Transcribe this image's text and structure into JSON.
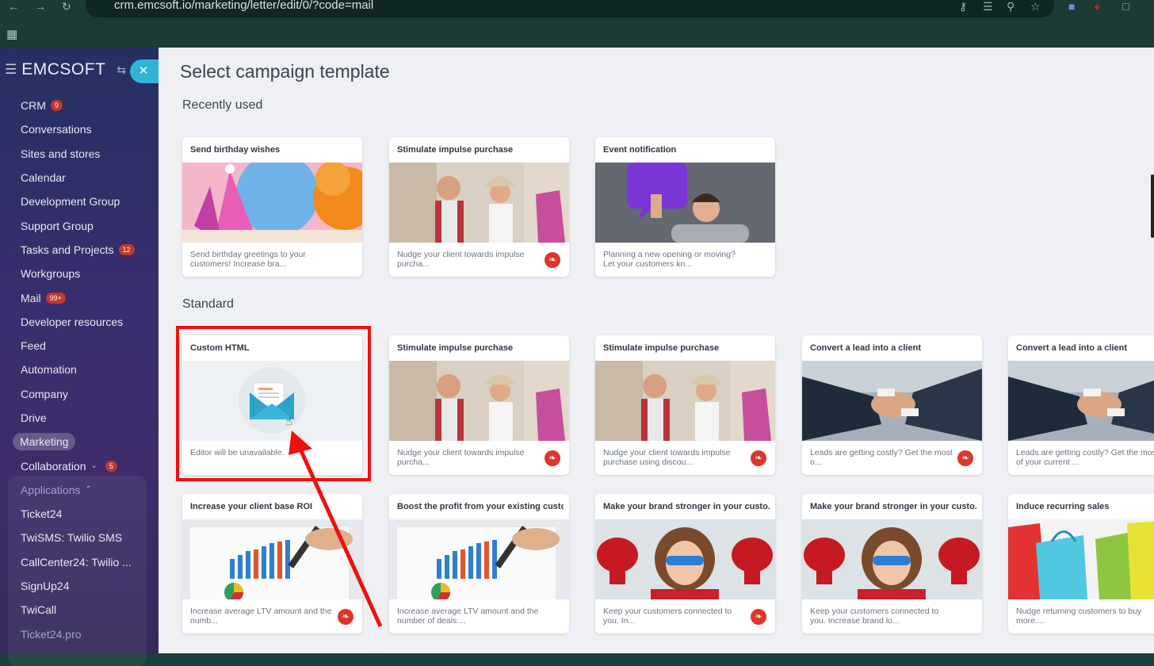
{
  "browser": {
    "url": "crm.emcsoft.io/marketing/letter/edit/0/?code=mail"
  },
  "sidebar": {
    "logo": "EMCSOFT",
    "items": [
      {
        "label": "CRM",
        "badge": "9"
      },
      {
        "label": "Conversations"
      },
      {
        "label": "Sites and stores"
      },
      {
        "label": "Calendar"
      },
      {
        "label": "Development Group"
      },
      {
        "label": "Support Group"
      },
      {
        "label": "Tasks and Projects",
        "badge": "12"
      },
      {
        "label": "Workgroups"
      },
      {
        "label": "Mail",
        "badge": "99+"
      },
      {
        "label": "Developer resources"
      },
      {
        "label": "Feed"
      },
      {
        "label": "Automation"
      },
      {
        "label": "Company"
      },
      {
        "label": "Drive"
      },
      {
        "label": "Marketing"
      },
      {
        "label": "Collaboration",
        "badge": "5"
      },
      {
        "label": "Applications"
      },
      {
        "label": "Ticket24"
      },
      {
        "label": "TwiSMS: Twilio SMS"
      },
      {
        "label": "CallCenter24: Twilio ..."
      },
      {
        "label": "SignUp24"
      },
      {
        "label": "TwiCall"
      },
      {
        "label": "Ticket24.pro"
      }
    ]
  },
  "page": {
    "title": "Select campaign template",
    "recent_heading": "Recently used",
    "standard_heading": "Standard"
  },
  "recent": [
    {
      "title": "Send birthday wishes",
      "desc": "Send birthday greetings to your customers! Increase bra...",
      "image": "balloons"
    },
    {
      "title": "Stimulate impulse purchase",
      "desc": "Nudge your client towards impulse purcha...",
      "image": "shoppers"
    },
    {
      "title": "Event notification",
      "desc": "Planning a new opening or moving? Let your customers kn...",
      "image": "speech-bubble"
    }
  ],
  "standard": [
    {
      "title": "Custom HTML",
      "desc": "Editor will be unavailable.",
      "image": "envelope-icon"
    },
    {
      "title": "Stimulate impulse purchase",
      "desc": "Nudge your client towards impulse purcha...",
      "image": "shoppers"
    },
    {
      "title": "Stimulate impulse purchase",
      "desc": "Nudge your client towards impulse purchase using discou...",
      "image": "shoppers"
    },
    {
      "title": "Convert a lead into a client",
      "desc": "Leads are getting costly? Get the most o...",
      "image": "handshake"
    },
    {
      "title": "Convert a lead into a client",
      "desc": "Leads are getting costly? Get the most of your current ...",
      "image": "handshake"
    },
    {
      "title": "Increase your client base ROI",
      "desc": "Increase average LTV amount and the numb...",
      "image": "chart-report"
    },
    {
      "title": "Boost the profit from your existing custo...",
      "desc": "Increase average LTV amount and the number of deals....",
      "image": "chart-report"
    },
    {
      "title": "Make your brand stronger in your custo...",
      "desc": "Keep your customers connected to you. In...",
      "image": "superhero-kid"
    },
    {
      "title": "Make your brand stronger in your custo...",
      "desc": "Keep your customers connected to you. Increase brand lo...",
      "image": "superhero-kid"
    },
    {
      "title": "Induce recurring sales",
      "desc": "Nudge returning customers to buy more....",
      "image": "shopping-bags"
    }
  ],
  "colors": {
    "accent": "#2fb4d8",
    "badge": "#c0392b",
    "highlight": "#ef1010",
    "fire": "#e0352b"
  }
}
